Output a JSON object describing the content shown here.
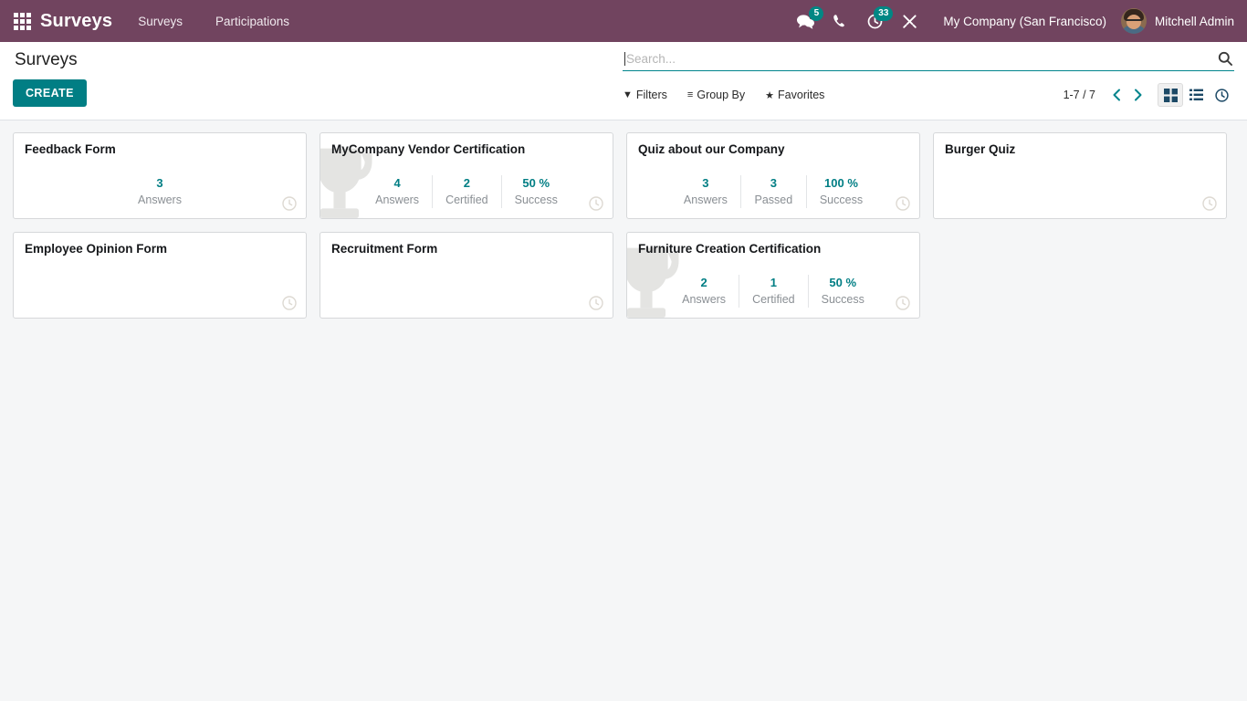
{
  "navbar": {
    "apps_icon": "apps-grid-icon",
    "brand": "Surveys",
    "menu": [
      {
        "label": "Surveys"
      },
      {
        "label": "Participations"
      }
    ],
    "sysicons": [
      {
        "name": "messages-icon",
        "badge": "5"
      },
      {
        "name": "phone-icon",
        "badge": ""
      },
      {
        "name": "activities-clock-icon",
        "badge": "33"
      },
      {
        "name": "debug-wrench-icon",
        "badge": ""
      }
    ],
    "company": "My Company (San Francisco)",
    "user_name": "Mitchell Admin",
    "avatar": "user-avatar"
  },
  "control_panel": {
    "page_title": "Surveys",
    "create_label": "CREATE",
    "search": {
      "value": "",
      "placeholder": "Search...",
      "icon": "search-icon"
    },
    "filters": [
      {
        "name": "filters",
        "icon": "funnel-icon",
        "label": "Filters"
      },
      {
        "name": "group-by",
        "icon": "bars-icon",
        "label": "Group By"
      },
      {
        "name": "favorites",
        "icon": "star-icon",
        "label": "Favorites"
      }
    ],
    "pager": "1-7 / 7",
    "views": [
      {
        "name": "kanban-view",
        "icon": "kanban-icon",
        "active": true
      },
      {
        "name": "list-view",
        "icon": "list-icon",
        "active": false
      },
      {
        "name": "activity-view",
        "icon": "clock-icon",
        "active": false
      }
    ]
  },
  "colors": {
    "navbar": "#71445f",
    "accent_teal": "#017e84",
    "badge": "#008784",
    "page_bg": "#f5f6f7",
    "card_border": "#d6d8da",
    "muted_label": "#8a8f94",
    "watermark": "#e4e4e2"
  },
  "cards": [
    {
      "title": "Feedback Form",
      "certification": false,
      "stats": [
        {
          "value": "3",
          "label": "Answers"
        }
      ]
    },
    {
      "title": "MyCompany Vendor Certification",
      "certification": true,
      "stats": [
        {
          "value": "4",
          "label": "Answers"
        },
        {
          "value": "2",
          "label": "Certified"
        },
        {
          "value": "50 %",
          "label": "Success"
        }
      ]
    },
    {
      "title": "Quiz about our Company",
      "certification": false,
      "stats": [
        {
          "value": "3",
          "label": "Answers"
        },
        {
          "value": "3",
          "label": "Passed"
        },
        {
          "value": "100 %",
          "label": "Success"
        }
      ]
    },
    {
      "title": "Burger Quiz",
      "certification": false,
      "stats": []
    },
    {
      "title": "Employee Opinion Form",
      "certification": false,
      "stats": []
    },
    {
      "title": "Recruitment Form",
      "certification": false,
      "stats": []
    },
    {
      "title": "Furniture Creation Certification",
      "certification": true,
      "stats": [
        {
          "value": "2",
          "label": "Answers"
        },
        {
          "value": "1",
          "label": "Certified"
        },
        {
          "value": "50 %",
          "label": "Success"
        }
      ]
    }
  ]
}
